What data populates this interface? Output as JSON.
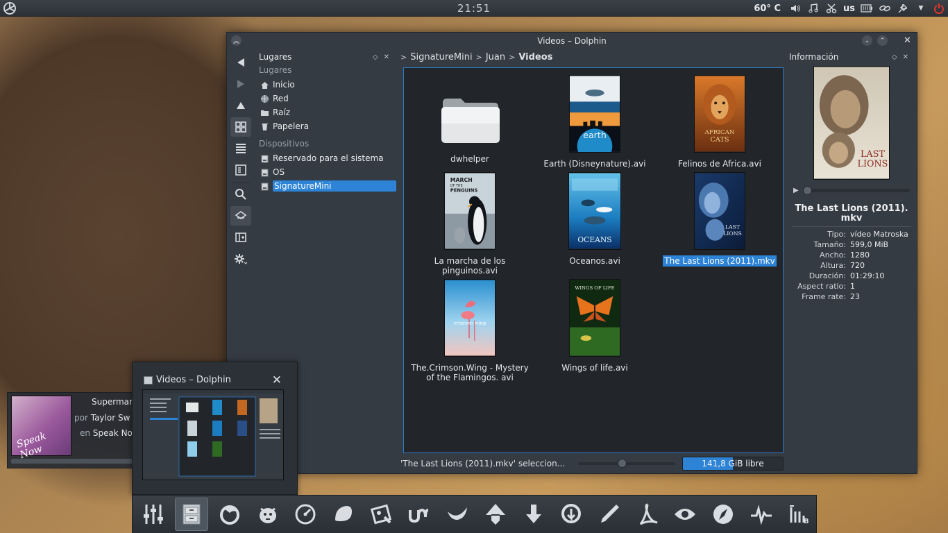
{
  "top_panel": {
    "clock": "21:51",
    "temperature": "60° C",
    "keyboard_layout": "us"
  },
  "window": {
    "title": "Videos – Dolphin",
    "places_panel": {
      "header": "Lugares",
      "section_places": "Lugares",
      "places": [
        {
          "label": "Inicio",
          "icon": "home-icon"
        },
        {
          "label": "Red",
          "icon": "network-icon"
        },
        {
          "label": "Raíz",
          "icon": "folder-icon"
        },
        {
          "label": "Papelera",
          "icon": "trash-icon"
        }
      ],
      "section_devices": "Dispositivos",
      "devices": [
        {
          "label": "Reservado para el sistema",
          "icon": "drive-icon"
        },
        {
          "label": "OS",
          "icon": "drive-icon"
        },
        {
          "label": "SignatureMini",
          "icon": "drive-icon",
          "selected": true
        }
      ]
    },
    "breadcrumb": [
      "SignatureMini",
      "Juan",
      "Videos"
    ],
    "files": [
      {
        "name": "dwhelper",
        "type": "folder"
      },
      {
        "name": "Earth (Disneynature).avi",
        "type": "video"
      },
      {
        "name": "Felinos de Africa.avi",
        "type": "video"
      },
      {
        "name": "La marcha de los pinguinos.avi",
        "type": "video"
      },
      {
        "name": "Oceanos.avi",
        "type": "video"
      },
      {
        "name": "The Last Lions (2011).mkv",
        "type": "video",
        "selected": true
      },
      {
        "name": "The.Crimson.Wing - Mystery of the Flamingos. avi",
        "type": "video"
      },
      {
        "name": "Wings of life.avi",
        "type": "video"
      }
    ],
    "poster_text": {
      "earth": "earth",
      "african_cats_top": "AFRICAN",
      "african_cats_bottom": "CATS",
      "march_top": "MARCH",
      "march_mid": "OF THE",
      "march_bottom": "PENGUINS",
      "oceans": "OCEANS",
      "last_lions_top": "LAST",
      "last_lions_bottom": "LIONS",
      "crimson_wing": "crimson wing",
      "wings_of_life": "WINGS OF LIFE"
    },
    "info_panel": {
      "header": "Información",
      "file_name": "The Last Lions (2011). mkv",
      "poster_top": "LAST",
      "poster_bottom": "LIONS",
      "progress": 0.0,
      "meta": [
        {
          "key": "Tipo:",
          "value": "vídeo Matroska"
        },
        {
          "key": "Tamaño:",
          "value": "599,0 MiB"
        },
        {
          "key": "Ancho:",
          "value": "1280"
        },
        {
          "key": "Altura:",
          "value": "720"
        },
        {
          "key": "Duración:",
          "value": "01:29:10"
        },
        {
          "key": "Aspect ratio:",
          "value": "1"
        },
        {
          "key": "Frame rate:",
          "value": "23"
        }
      ]
    },
    "status": {
      "message": "'The Last Lions (2011).mkv' seleccion...",
      "zoom_level": 0.45,
      "free_space": "141,8 GiB libre",
      "used_fraction": 0.5
    }
  },
  "media_widget": {
    "song": "Supermar",
    "by_label": "por",
    "artist": "Taylor Sw",
    "in_label": "en",
    "album": "Speak No",
    "cover_text": "Speak Now",
    "progress": 0.0
  },
  "task_preview": {
    "title": "Videos – Dolphin"
  },
  "dock": {
    "launchers": [
      "mixer-icon",
      "file-manager-icon",
      "firefox-icon",
      "gimp-icon",
      "speedometer-icon",
      "shape-icon",
      "video-editor-icon",
      "ubuntu-one-icon",
      "mixxx-icon",
      "inkscape-icon",
      "download-icon",
      "update-icon",
      "pen-icon",
      "acrobat-icon",
      "eye-icon",
      "compass-icon",
      "pulse-icon",
      "imdb-icon"
    ],
    "active_index": 1,
    "colors": {
      "accent": "#2d84d6"
    }
  }
}
